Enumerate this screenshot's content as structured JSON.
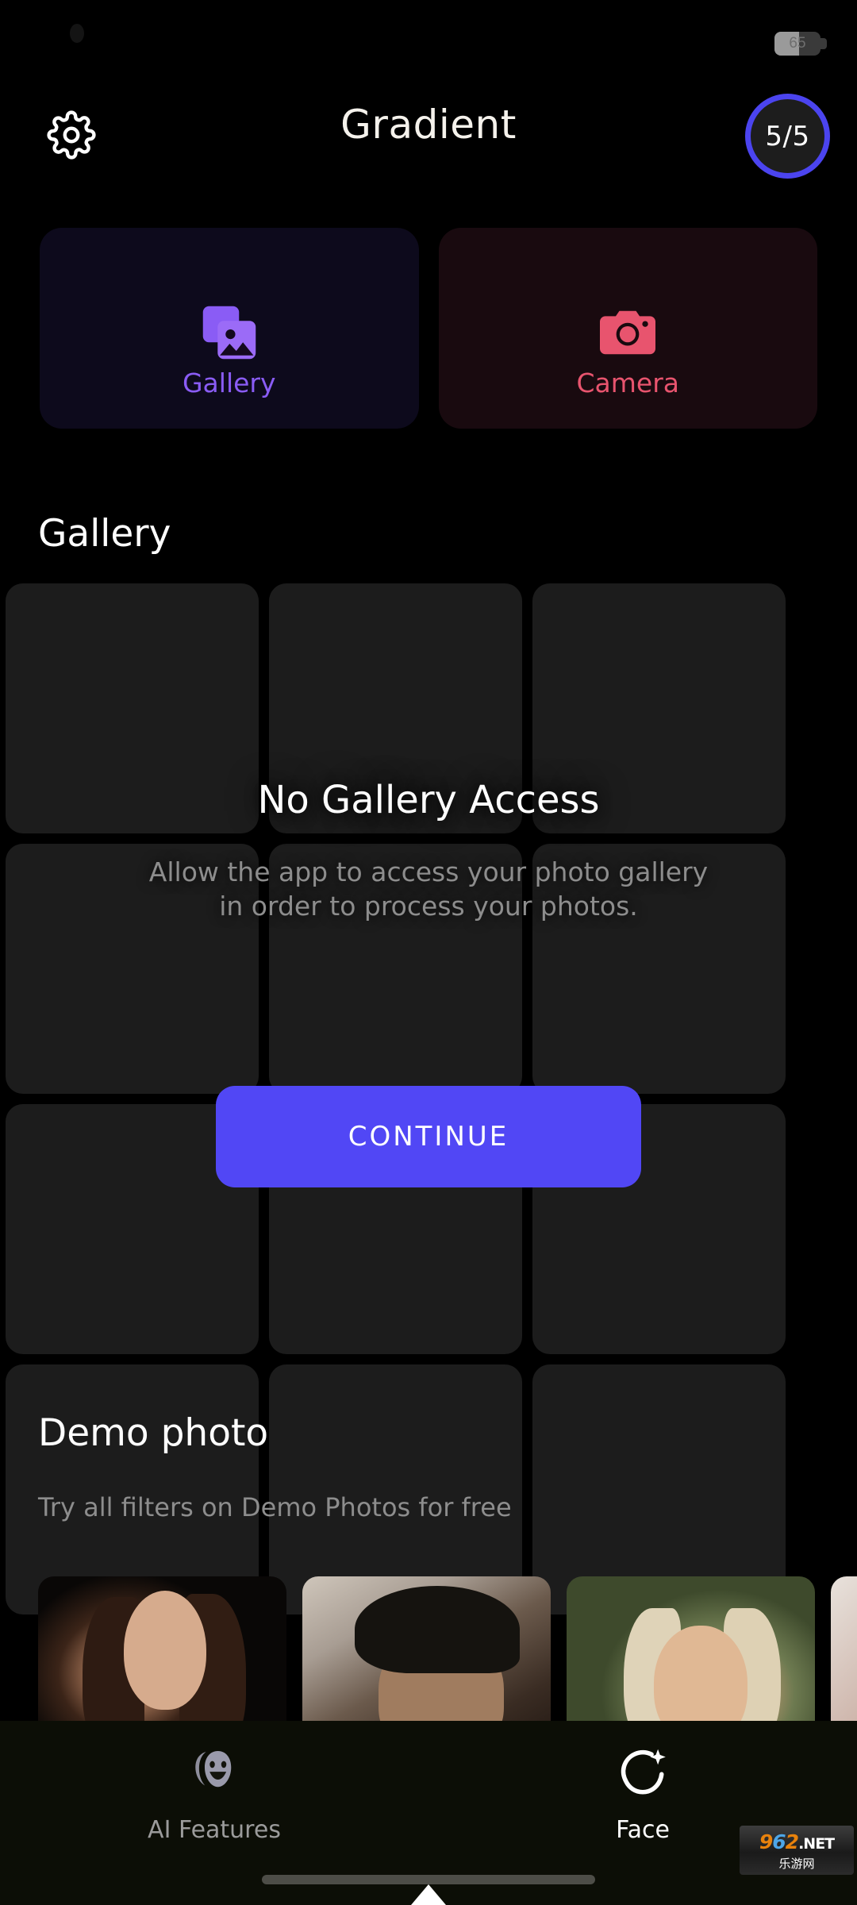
{
  "status_bar": {
    "battery_percent": "65",
    "battery_level": 65
  },
  "app_bar": {
    "title": "Gradient",
    "settings_icon": "gear-icon",
    "counter": "5/5"
  },
  "source_cards": [
    {
      "label": "Gallery",
      "icon": "images-icon",
      "accent": "#8a5cf5",
      "background": "#0d0a1c"
    },
    {
      "label": "Camera",
      "icon": "camera-icon",
      "accent": "#e8546e",
      "background": "#190a0f"
    }
  ],
  "gallery_section": {
    "heading": "Gallery",
    "tile_count": 12,
    "tile_color": "#1c1c1c"
  },
  "permission": {
    "title": "No Gallery Access",
    "description": "Allow the app to access your photo gallery in order to process your photos.",
    "button_label": "CONTINUE",
    "button_color": "#5147f5"
  },
  "demo_section": {
    "heading": "Demo photo",
    "subtitle": "Try all filters on Demo Photos for free",
    "thumbnails": [
      {
        "alt": "brunette-woman-portrait"
      },
      {
        "alt": "man-in-black-cap-portrait"
      },
      {
        "alt": "blonde-woman-smiling-portrait"
      },
      {
        "alt": "partial-portrait"
      }
    ]
  },
  "bottom_nav": {
    "items": [
      {
        "label": "AI Features",
        "icon": "theater-mask-icon",
        "active": false
      },
      {
        "label": "Face",
        "icon": "face-sparkle-icon",
        "active": true
      }
    ]
  },
  "watermark": {
    "digit_9": "9",
    "digit_6": "6",
    "digit_2": "2",
    "domain": ".NET",
    "subtitle": "乐游网"
  }
}
